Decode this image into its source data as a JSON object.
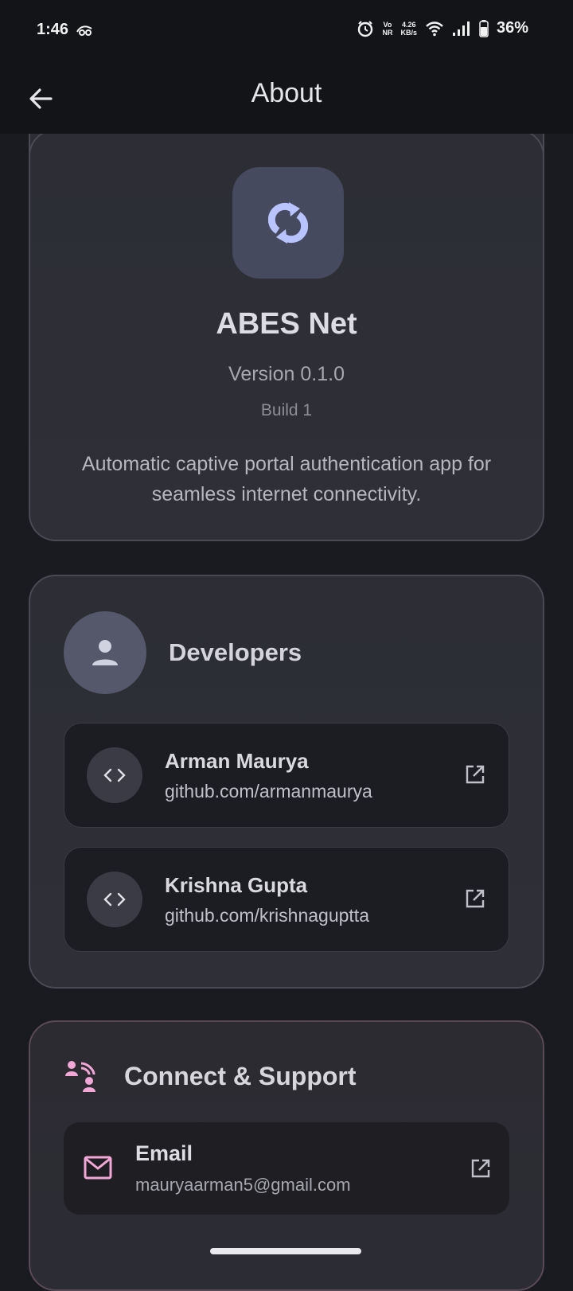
{
  "status_bar": {
    "time": "1:46",
    "network_speed_value": "4.26",
    "network_speed_unit": "KB/s",
    "volte_top": "Vo",
    "volte_bottom": "NR",
    "battery": "36%",
    "icons": [
      "carrier-icon",
      "alarm-icon",
      "volte-icon",
      "wifi-icon",
      "signal-icon",
      "battery-icon"
    ]
  },
  "app_bar": {
    "title": "About",
    "back_icon": "arrow-left-icon"
  },
  "about": {
    "app_name": "ABES Net",
    "version": "Version 0.1.0",
    "build": "Build 1",
    "description": "Automatic captive portal authentication app for seamless internet connectivity.",
    "icon": "sync-icon"
  },
  "developers": {
    "title": "Developers",
    "items": [
      {
        "name": "Arman Maurya",
        "link": "github.com/armanmaurya"
      },
      {
        "name": "Krishna Gupta",
        "link": "github.com/krishnaguptta"
      }
    ]
  },
  "support": {
    "title": "Connect & Support",
    "email": {
      "label": "Email",
      "value": "mauryaarman5@gmail.com"
    }
  },
  "colors": {
    "background": "#1a1b20",
    "card": "#2c2d35",
    "accent": "#b9c3ff",
    "support_accent": "#f2a7d6"
  }
}
